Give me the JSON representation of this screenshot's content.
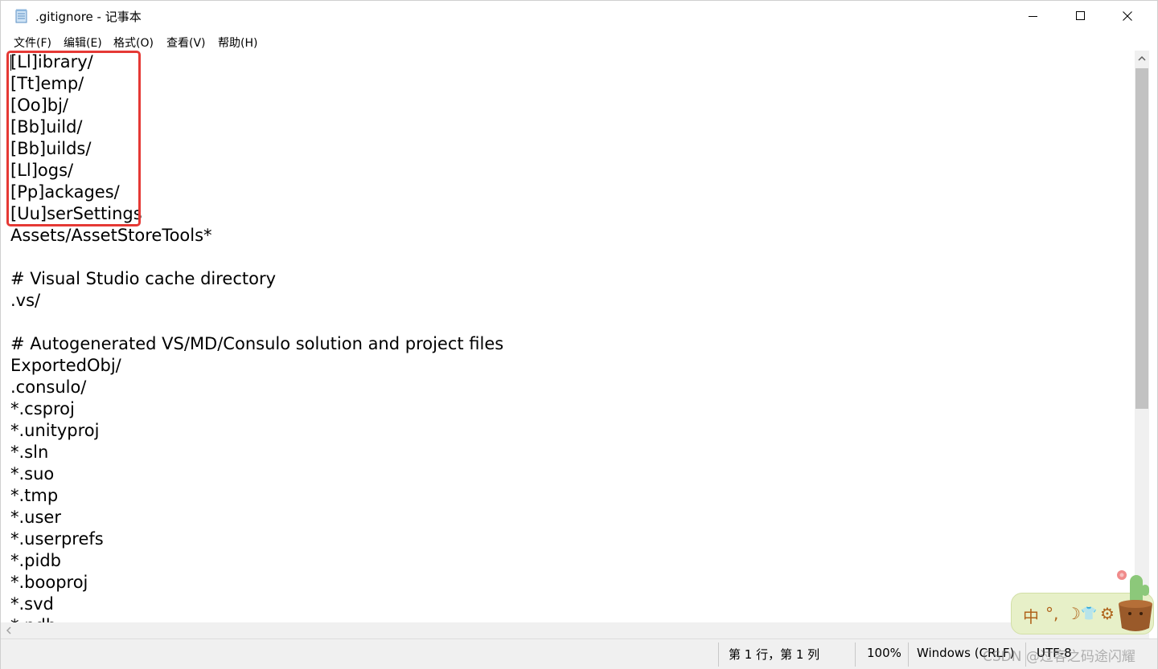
{
  "window": {
    "title": ".gitignore - 记事本"
  },
  "menu": {
    "items": [
      {
        "label": "文件(F)"
      },
      {
        "label": "编辑(E)"
      },
      {
        "label": "格式(O)"
      },
      {
        "label": "查看(V)"
      },
      {
        "label": "帮助(H)"
      }
    ]
  },
  "editor": {
    "lines": [
      "[Ll]ibrary/",
      "[Tt]emp/",
      "[Oo]bj/",
      "[Bb]uild/",
      "[Bb]uilds/",
      "[Ll]ogs/",
      "[Pp]ackages/",
      "[Uu]serSettings",
      "Assets/AssetStoreTools*",
      "",
      "# Visual Studio cache directory",
      ".vs/",
      "",
      "# Autogenerated VS/MD/Consulo solution and project files",
      "ExportedObj/",
      ".consulo/",
      "*.csproj",
      "*.unityproj",
      "*.sln",
      "*.suo",
      "*.tmp",
      "*.user",
      "*.userprefs",
      "*.pidb",
      "*.booproj",
      "*.svd",
      "*.pdb"
    ],
    "highlight_color": "#e53935"
  },
  "status": {
    "position": "第 1 行，第 1 列",
    "zoom": "100%",
    "line_ending": "Windows (CRLF)",
    "encoding": "UTF-8"
  },
  "watermark": {
    "text": "CSDN @过客之码途闪耀"
  },
  "ime": {
    "items": [
      "中",
      "°,",
      "☽",
      "👕",
      "⚙"
    ]
  }
}
